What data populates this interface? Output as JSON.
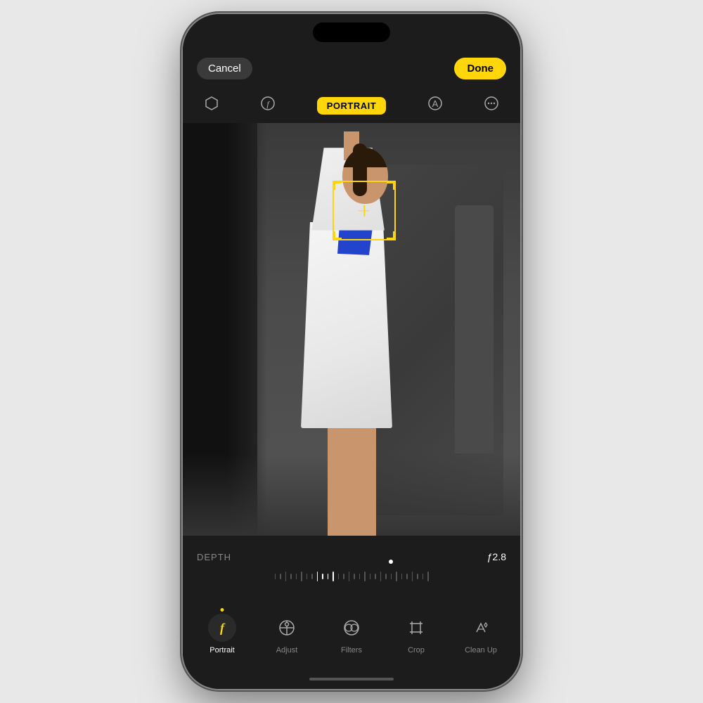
{
  "phone": {
    "statusBar": {
      "dynamicIsland": true
    },
    "topToolbar": {
      "cancelLabel": "Cancel",
      "doneLabel": "Done"
    },
    "modeToolbar": {
      "portraitLabel": "PORTRAIT",
      "icons": [
        "hexagon",
        "f-lightning",
        "A",
        "ellipsis"
      ]
    },
    "depthControl": {
      "depthLabel": "DEPTH",
      "apertureValue": "ƒ2.8"
    },
    "tools": [
      {
        "id": "portrait",
        "label": "Portrait",
        "active": true
      },
      {
        "id": "adjust",
        "label": "Adjust",
        "active": false
      },
      {
        "id": "filters",
        "label": "Filters",
        "active": false
      },
      {
        "id": "crop",
        "label": "Crop",
        "active": false
      },
      {
        "id": "cleanup",
        "label": "Clean Up",
        "active": false
      }
    ],
    "faceBox": {
      "visible": true
    },
    "colors": {
      "accent": "#FFD60A",
      "background": "#1c1c1c",
      "activeText": "#ffffff",
      "inactiveText": "#888888"
    }
  }
}
